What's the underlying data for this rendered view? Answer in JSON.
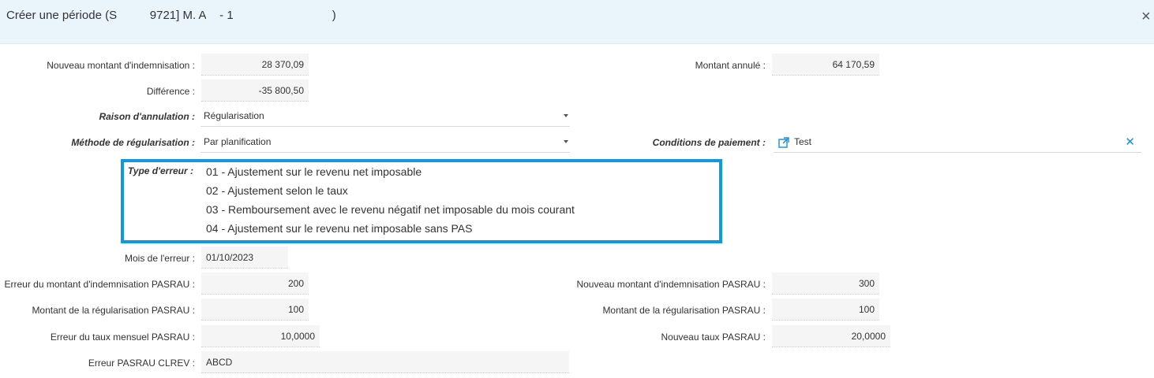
{
  "dialog": {
    "title_prefix": "Créer une période (S",
    "title_mid": "9721] M. A",
    "title_mid2": "- 1",
    "title_suffix": ")",
    "close_glyph": "×"
  },
  "fields": {
    "nouveau_montant_label": "Nouveau montant d'indemnisation :",
    "nouveau_montant_value": "28 370,09",
    "montant_annule_label": "Montant annulé :",
    "montant_annule_value": "64 170,59",
    "difference_label": "Différence :",
    "difference_value": "-35 800,50",
    "raison_label": "Raison d'annulation :",
    "raison_value": "Régularisation",
    "methode_label": "Méthode de régularisation :",
    "methode_value": "Par planification",
    "conditions_label": "Conditions de paiement :",
    "conditions_value": "Test",
    "type_erreur_label": "Type d'erreur :",
    "type_erreur_options": [
      "01 - Ajustement sur le revenu net imposable",
      "02 - Ajustement selon le taux",
      "03 - Remboursement avec le revenu négatif net imposable du mois courant",
      "04 - Ajustement sur le revenu net imposable sans PAS"
    ],
    "mois_erreur_label": "Mois de l'erreur :",
    "mois_erreur_value": "01/10/2023",
    "erreur_montant_label": "Erreur du montant d'indemnisation PASRAU :",
    "erreur_montant_value": "200",
    "nouveau_montant_pasrau_label": "Nouveau montant d'indemnisation PASRAU :",
    "nouveau_montant_pasrau_value": "300",
    "montant_regul_left_label": "Montant de la régularisation PASRAU :",
    "montant_regul_left_value": "100",
    "montant_regul_right_label": "Montant de la régularisation PASRAU :",
    "montant_regul_right_value": "100",
    "erreur_taux_label": "Erreur du taux mensuel PASRAU :",
    "erreur_taux_value": "10,0000",
    "nouveau_taux_label": "Nouveau taux PASRAU :",
    "nouveau_taux_value": "20,0000",
    "erreur_clrev_label": "Erreur PASRAU CLREV :",
    "erreur_clrev_value": "ABCD"
  },
  "colors": {
    "header_bg": "#eaf4fb",
    "highlight_border": "#0f9ae0",
    "accent": "#1a8fd6"
  },
  "icons": {
    "close": "close-icon",
    "dropdown": "chevron-down-icon",
    "external_link": "external-link-icon",
    "clear": "clear-icon"
  }
}
